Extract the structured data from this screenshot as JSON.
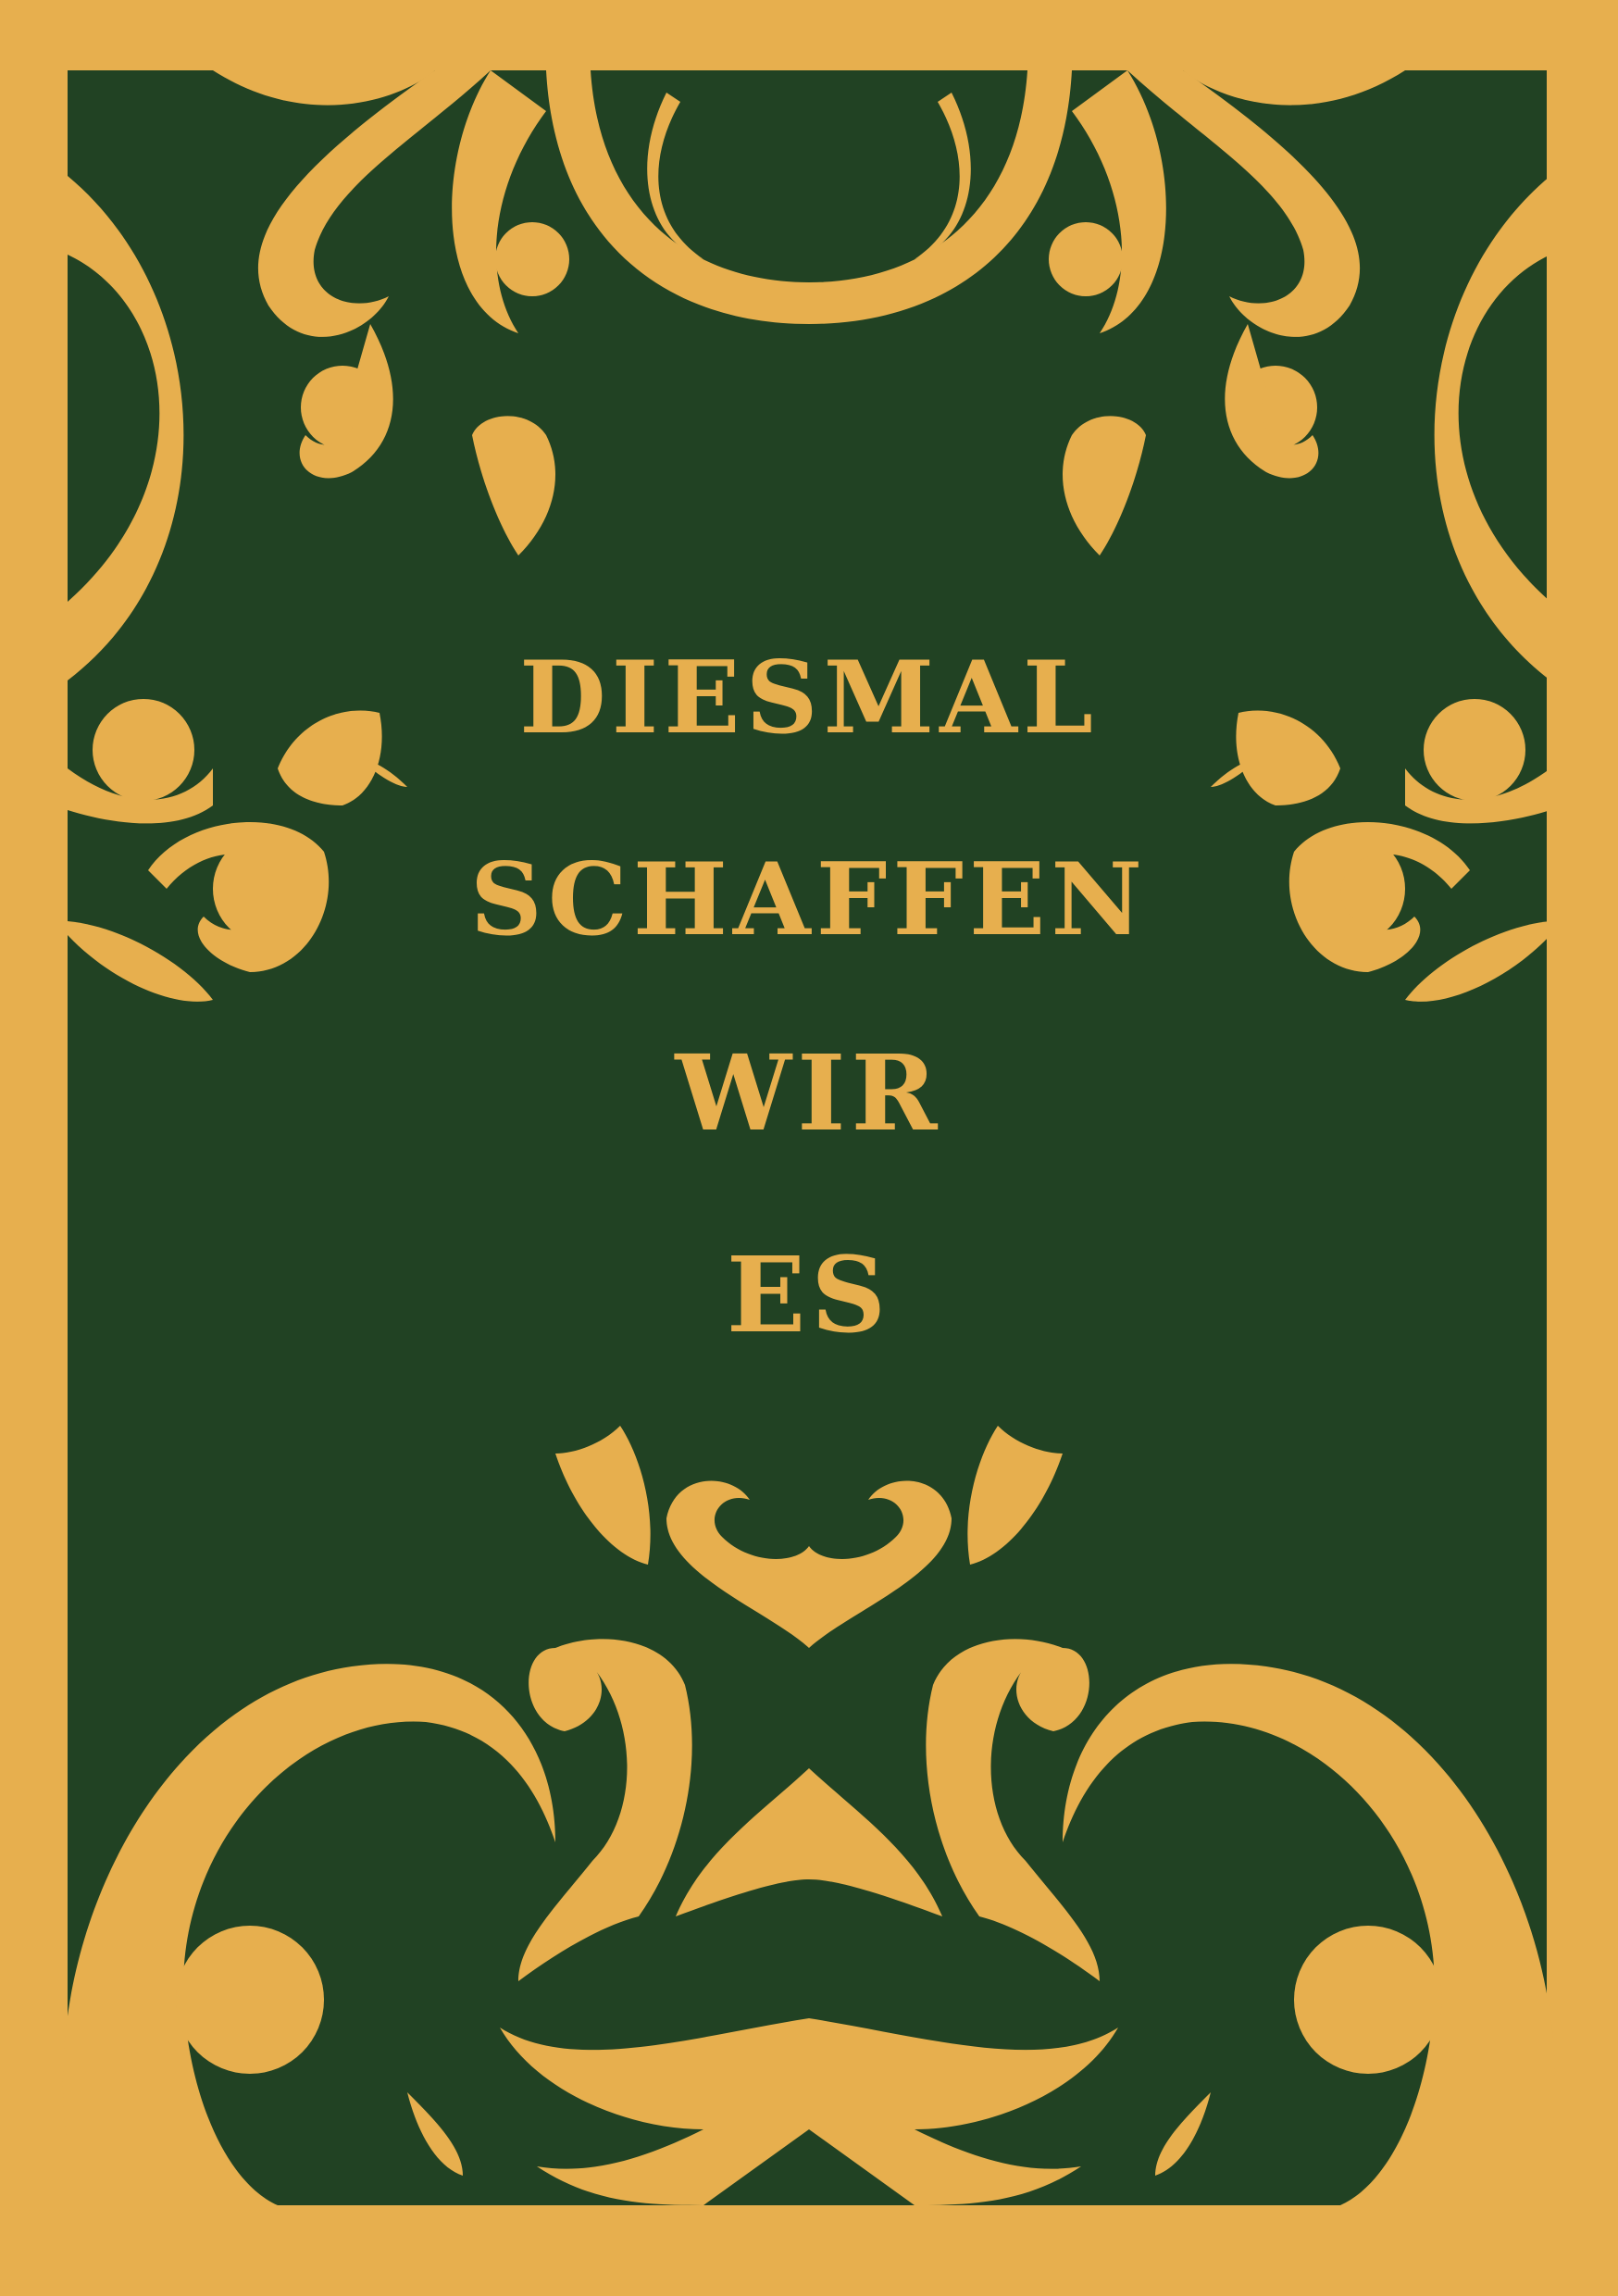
{
  "poster": {
    "lines": [
      "DIESMAL",
      "SCHAFFEN",
      "WIR",
      "ES"
    ]
  },
  "colors": {
    "frame": "#e7af4e",
    "panel": "#214223",
    "text": "#e7af4e"
  },
  "ornament_icon": "baroque-flourish-icon"
}
